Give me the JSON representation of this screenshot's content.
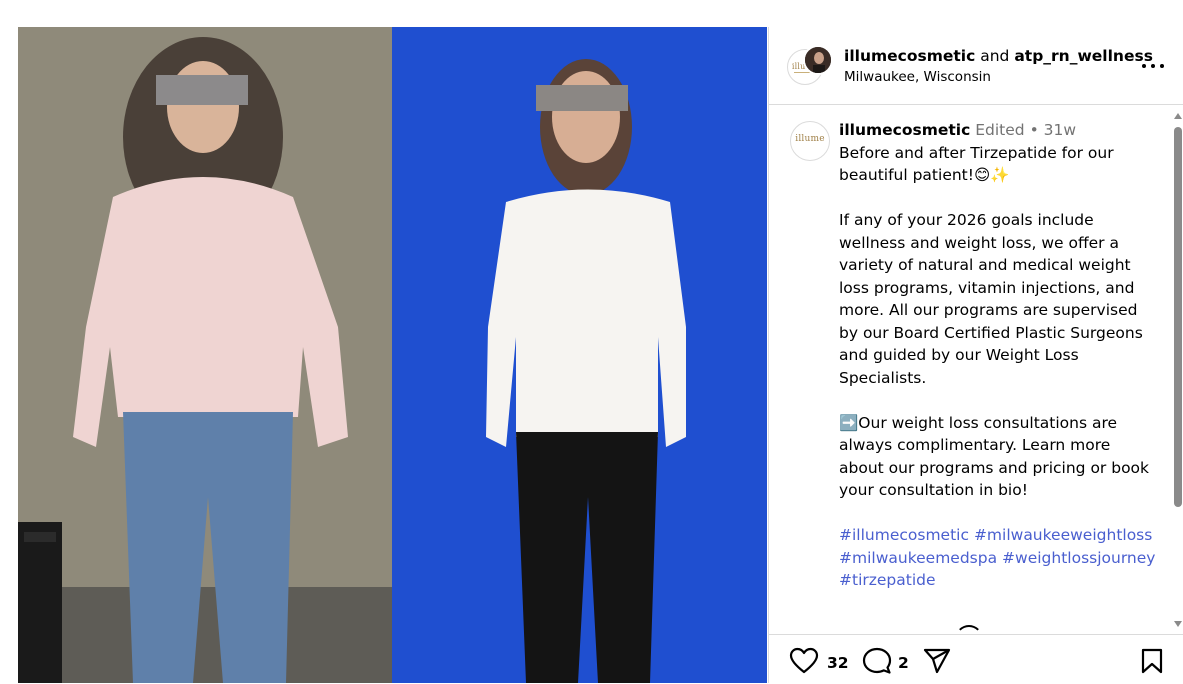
{
  "post": {
    "author": "illumecosmetic",
    "and_text": "and",
    "collaborator": "atp_rn_wellness",
    "location": "Milwaukee, Wisconsin",
    "avatar_logo": "illume",
    "more_icon": "more-horizontal-icon"
  },
  "caption": {
    "username": "illumecosmetic",
    "edited": "Edited",
    "separator": "•",
    "age": "31w",
    "paragraph1": "Before and after Tirzepatide for our beautiful patient!😊✨",
    "paragraph2": "If any of your 2026 goals include wellness and weight loss, we offer a variety of natural and medical weight loss programs, vitamin injections, and more. All our programs are supervised by our Board Certified Plastic Surgeons and guided by our Weight Loss Specialists.",
    "paragraph3": "➡️Our weight loss consultations are always complimentary. Learn more about our programs and pricing or book your consultation in bio!",
    "hashtags": [
      "#illumecosmetic",
      "#milwaukeeweightloss",
      "#milwaukeemedspa",
      "#weightlossjourney",
      "#tirzepatide"
    ]
  },
  "actions": {
    "likes": "32",
    "comments": "2",
    "icons": [
      "heart-icon",
      "comment-icon",
      "share-icon",
      "bookmark-icon"
    ]
  },
  "colors": {
    "hashtag": "#4a5fcf",
    "meta": "#737373",
    "border": "#dbdbdb",
    "before_bg": "#8f8a7a",
    "after_bg": "#1f4fd0"
  }
}
